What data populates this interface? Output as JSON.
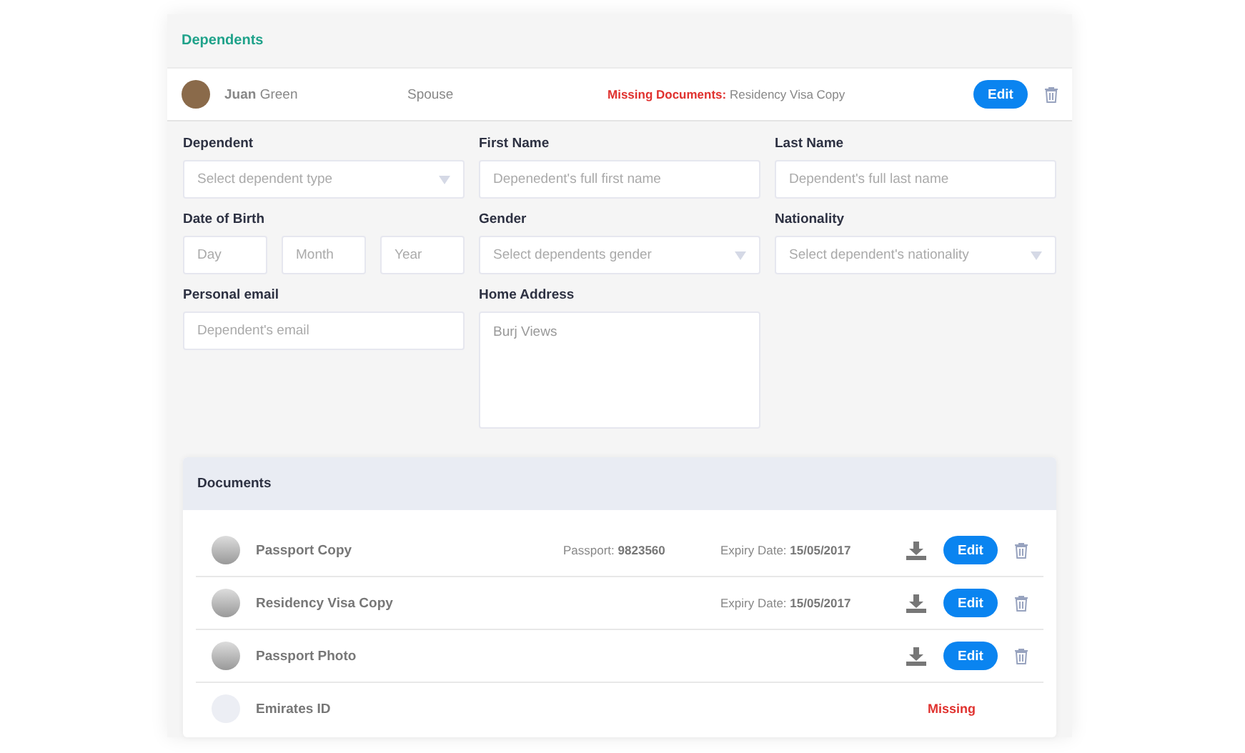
{
  "section_title": "Dependents",
  "dependent": {
    "first_name": "Juan",
    "last_name": "Green",
    "relation": "Spouse",
    "missing_label": "Missing Documents:",
    "missing_value": "Residency Visa Copy",
    "edit_label": "Edit"
  },
  "form": {
    "fields": [
      {
        "kind": "select",
        "label": "Dependent",
        "placeholder": "Select dependent type"
      },
      {
        "kind": "text",
        "label": "First Name",
        "placeholder": "Depenedent's full first name"
      },
      {
        "kind": "text",
        "label": "Last Name",
        "placeholder": "Dependent's full last name"
      },
      {
        "kind": "date",
        "label": "Date of Birth",
        "parts": [
          {
            "placeholder": "Day"
          },
          {
            "placeholder": "Month"
          },
          {
            "placeholder": "Year"
          }
        ]
      },
      {
        "kind": "select",
        "label": "Gender",
        "placeholder": "Select dependents gender"
      },
      {
        "kind": "select",
        "label": "Nationality",
        "placeholder": "Select dependent's nationality"
      },
      {
        "kind": "text",
        "label": "Personal email",
        "placeholder": "Dependent's email"
      },
      {
        "kind": "textarea",
        "label": "Home Address",
        "value": "Burj Views"
      }
    ]
  },
  "documents": {
    "title": "Documents",
    "rows": [
      {
        "kind": "uploaded",
        "name": "Passport Copy",
        "number_label": "Passport:",
        "number": "9823560",
        "expiry_label": "Expiry Date:",
        "expiry": "15/05/2017",
        "edit_label": "Edit"
      },
      {
        "kind": "uploaded",
        "name": "Residency Visa Copy",
        "expiry_label": "Expiry Date:",
        "expiry": "15/05/2017",
        "edit_label": "Edit"
      },
      {
        "kind": "uploaded",
        "name": "Passport Photo",
        "edit_label": "Edit"
      },
      {
        "kind": "missing",
        "name": "Emirates ID",
        "status": "Missing"
      }
    ]
  }
}
